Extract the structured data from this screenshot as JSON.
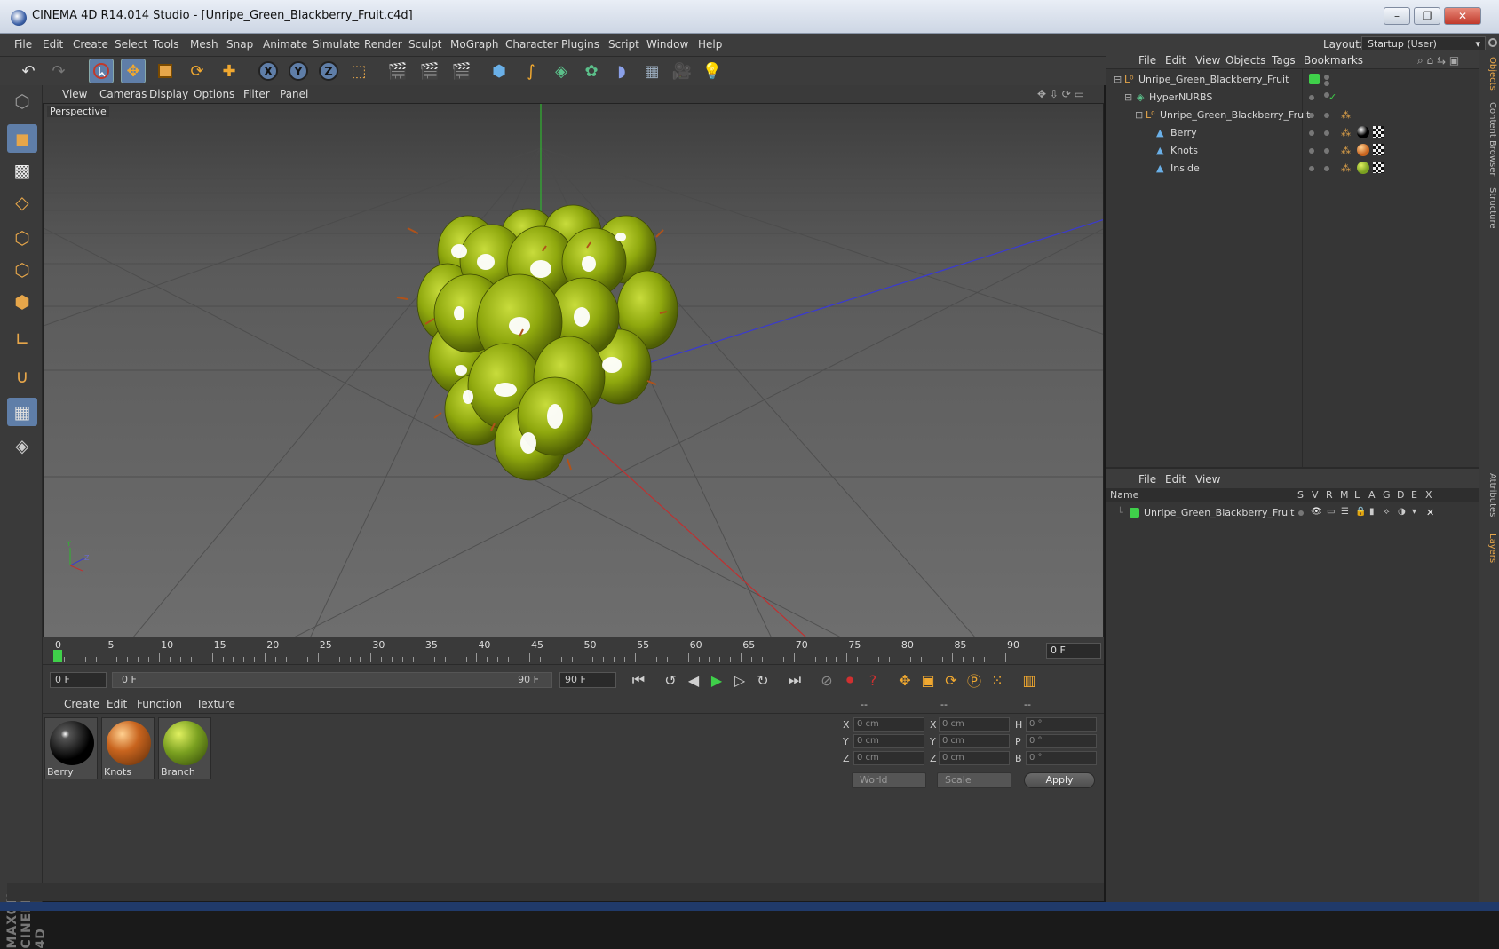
{
  "app": {
    "title": "CINEMA 4D R14.014 Studio - [Unripe_Green_Blackberry_Fruit.c4d]",
    "brand_line1": "MAXON",
    "brand_line2": "CINEMA 4D"
  },
  "menu": [
    "File",
    "Edit",
    "Create",
    "Select",
    "Tools",
    "Mesh",
    "Snap",
    "Animate",
    "Simulate",
    "Render",
    "Sculpt",
    "MoGraph",
    "Character",
    "Plugins",
    "Script",
    "Window",
    "Help"
  ],
  "layout": {
    "label": "Layout:",
    "value": "Startup (User)"
  },
  "viewport": {
    "menu": [
      "View",
      "Cameras",
      "Display",
      "Options",
      "Filter",
      "Panel"
    ],
    "label": "Perspective",
    "axis_y": "Y",
    "axis_z": "Z"
  },
  "timeline": {
    "ticks": [
      "0",
      "5",
      "10",
      "15",
      "20",
      "25",
      "30",
      "35",
      "40",
      "45",
      "50",
      "55",
      "60",
      "65",
      "70",
      "75",
      "80",
      "85",
      "90"
    ],
    "current_frame": "0 F",
    "start_field": "0 F",
    "range_start": "0 F",
    "range_end": "90 F",
    "end_field": "90 F"
  },
  "materials": {
    "menu": [
      "Create",
      "Edit",
      "Function",
      "Texture"
    ],
    "items": [
      {
        "name": "Berry",
        "color": "#000000"
      },
      {
        "name": "Knots",
        "color": "#c8641e"
      },
      {
        "name": "Branch",
        "color": "#7aa020"
      }
    ]
  },
  "coords": {
    "headers": [
      "--",
      "--",
      "--"
    ],
    "rows": [
      {
        "l1": "X",
        "v1": "0 cm",
        "l2": "X",
        "v2": "0 cm",
        "l3": "H",
        "v3": "0 °"
      },
      {
        "l1": "Y",
        "v1": "0 cm",
        "l2": "Y",
        "v2": "0 cm",
        "l3": "P",
        "v3": "0 °"
      },
      {
        "l1": "Z",
        "v1": "0 cm",
        "l2": "Z",
        "v2": "0 cm",
        "l3": "B",
        "v3": "0 °"
      }
    ],
    "space": "World",
    "mode": "Scale",
    "apply": "Apply"
  },
  "objects": {
    "menu": [
      "File",
      "Edit",
      "View",
      "Objects",
      "Tags",
      "Bookmarks"
    ],
    "tree": [
      {
        "name": "Unripe_Green_Blackberry_Fruit",
        "depth": 0
      },
      {
        "name": "HyperNURBS",
        "depth": 1
      },
      {
        "name": "Unripe_Green_Blackberry_Fruit",
        "depth": 2
      },
      {
        "name": "Berry",
        "depth": 3
      },
      {
        "name": "Knots",
        "depth": 3
      },
      {
        "name": "Inside",
        "depth": 3
      }
    ]
  },
  "layers": {
    "menu": [
      "File",
      "Edit",
      "View"
    ],
    "columns": [
      "Name",
      "S",
      "V",
      "R",
      "M",
      "L",
      "A",
      "G",
      "D",
      "E",
      "X"
    ],
    "rows": [
      {
        "name": "Unripe_Green_Blackberry_Fruit"
      }
    ]
  },
  "side_tabs": [
    "Objects",
    "Content Browser",
    "Structure",
    "Attributes",
    "Layers"
  ],
  "colors": {
    "accent": "#e6a64a",
    "selection": "#5f7ea8",
    "layer_green": "#3fd04a"
  }
}
